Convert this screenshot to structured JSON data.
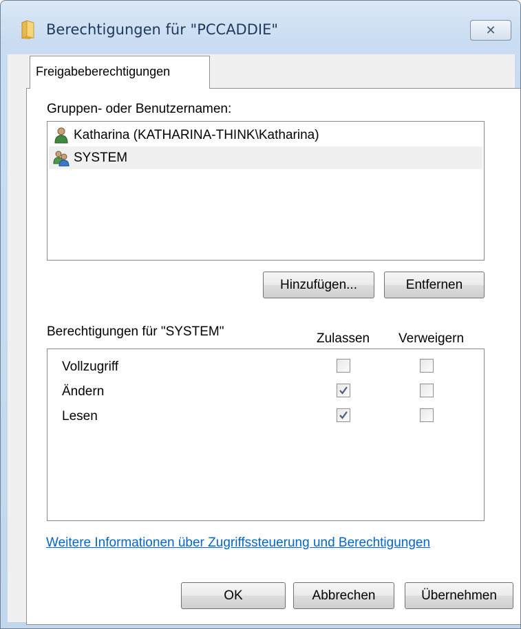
{
  "window": {
    "title": "Berechtigungen für \"PCCADDIE\"",
    "close_label": "✕"
  },
  "tabs": [
    {
      "label": "Freigabeberechtigungen",
      "active": true
    }
  ],
  "groups": {
    "label": "Gruppen- oder Benutzernamen:",
    "items": [
      {
        "name": "Katharina (KATHARINA-THINK\\Katharina)",
        "icon": "user-icon",
        "selected": false
      },
      {
        "name": "SYSTEM",
        "icon": "group-icon",
        "selected": true
      }
    ],
    "add_label": "Hinzufügen...",
    "remove_label": "Entfernen"
  },
  "permissions": {
    "label": "Berechtigungen für \"SYSTEM\"",
    "allow_header": "Zulassen",
    "deny_header": "Verweigern",
    "rows": [
      {
        "name": "Vollzugriff",
        "allow": false,
        "deny": false
      },
      {
        "name": "Ändern",
        "allow": true,
        "deny": false
      },
      {
        "name": "Lesen",
        "allow": true,
        "deny": false
      }
    ]
  },
  "info_link": "Weitere Informationen über Zugriffssteuerung und Berechtigungen",
  "footer": {
    "ok_label": "OK",
    "cancel_label": "Abbrechen",
    "apply_label": "Übernehmen"
  },
  "colors": {
    "link": "#0066cc",
    "title_text": "#1e395b",
    "selection": "#f0f0f0"
  }
}
